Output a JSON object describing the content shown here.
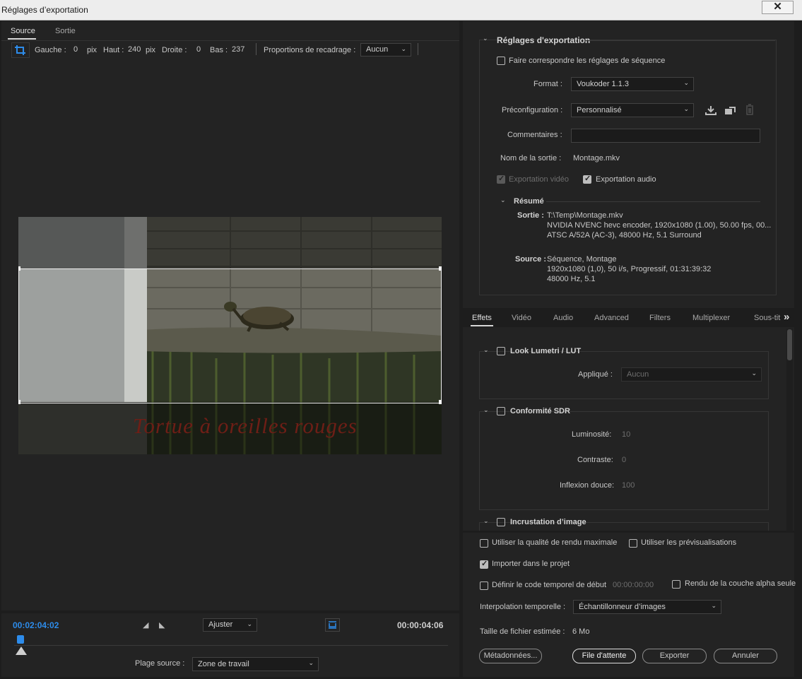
{
  "window": {
    "title": "Réglages d’exportation",
    "close_label": "✕"
  },
  "left_tabs": [
    "Source",
    "Sortie"
  ],
  "crop": {
    "left_label": "Gauche :",
    "left_value": "0",
    "unit1": "pix",
    "top_label": "Haut :",
    "top_value": "240",
    "unit2": "pix",
    "right_label": "Droite :",
    "right_value": "0",
    "bottom_label": "Bas :",
    "bottom_value": "237",
    "ratio_label": "Proportions de recadrage :",
    "ratio_value": "Aucun"
  },
  "preview": {
    "caption": "Tortue à oreilles rouges"
  },
  "timeline": {
    "current_time": "00:02:04:02",
    "duration": "00:00:04:06",
    "zoom_value": "Ajuster",
    "range_label": "Plage source :",
    "range_value": "Zone de travail"
  },
  "export_settings": {
    "heading": "Réglages d'exportation",
    "match_label": "Faire correspondre les réglages de séquence",
    "format_label": "Format :",
    "format_value": "Voukoder 1.1.3",
    "preset_label": "Préconfiguration :",
    "preset_value": "Personnalisé",
    "comments_label": "Commentaires :",
    "output_name_label": "Nom de la sortie :",
    "output_name_value": "Montage.mkv",
    "export_video_label": "Exportation vidéo",
    "export_audio_label": "Exportation audio",
    "summary_heading": "Résumé",
    "output_label": "Sortie :",
    "output_lines": [
      "T:\\Temp\\Montage.mkv",
      "NVIDIA NVENC hevc encoder, 1920x1080 (1.00), 50.00 fps, 00...",
      "ATSC A/52A (AC-3), 48000 Hz, 5.1 Surround"
    ],
    "source_label": "Source :",
    "source_lines": [
      "Séquence, Montage",
      "1920x1080 (1,0), 50  i/s, Progressif, 01:31:39:32",
      "48000 Hz, 5.1"
    ]
  },
  "effect_tabs": [
    "Effets",
    "Vidéo",
    "Audio",
    "Advanced",
    "Filters",
    "Multiplexer",
    "Sous-tit"
  ],
  "effect_tabs_more": "»",
  "effects": {
    "lumetri_title": "Look Lumetri / LUT",
    "applied_label": "Appliqué :",
    "applied_value": "Aucun",
    "sdr_title": "Conformité SDR",
    "brightness_label": "Luminosité:",
    "brightness_value": "10",
    "contrast_label": "Contraste:",
    "contrast_value": "0",
    "knee_label": "Inflexion douce:",
    "knee_value": "100",
    "overlay_title": "Incrustation d’image"
  },
  "bottom": {
    "max_quality_label": "Utiliser la qualité de rendu maximale",
    "previews_label": "Utiliser les prévisualisations",
    "import_label": "Importer dans le projet",
    "timecode_label": "Définir le code temporel de début",
    "timecode_value": "00:00:00:00",
    "alpha_label": "Rendu de la couche alpha seule",
    "interp_label": "Interpolation temporelle :",
    "interp_value": "Échantillonneur d’images",
    "filesize_label": "Taille de fichier estimée :",
    "filesize_value": "6 Mo",
    "metadata_button": "Métadonnées...",
    "queue_button": "File d'attente",
    "export_button": "Exporter",
    "cancel_button": "Annuler"
  }
}
